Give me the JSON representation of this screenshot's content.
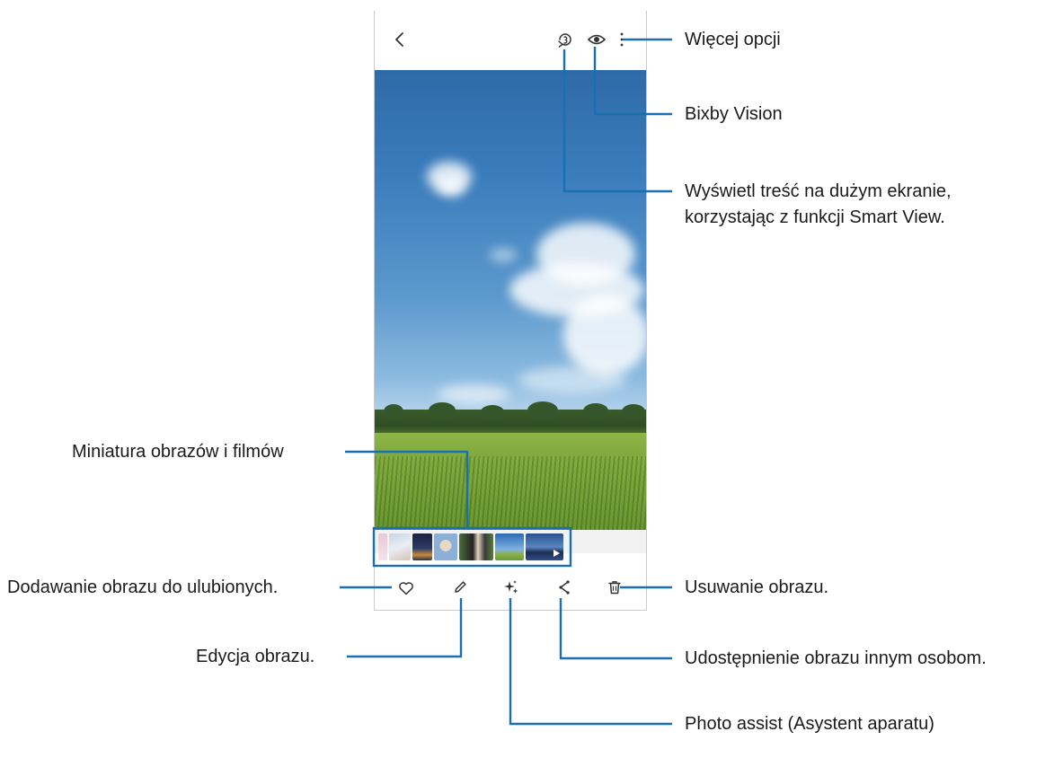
{
  "callouts": {
    "more_options": "Więcej opcji",
    "bixby_vision": "Bixby Vision",
    "smart_view_line1": "Wyświetl treść na dużym ekranie,",
    "smart_view_line2": "korzystając z funkcji Smart View.",
    "thumbnails": "Miniatura obrazów i filmów",
    "favorite": "Dodawanie obrazu do ulubionych.",
    "delete": "Usuwanie obrazu.",
    "share": "Udostępnienie obrazu innym osobom.",
    "edit": "Edycja obrazu.",
    "photo_assist": "Photo assist (Asystent aparatu)"
  },
  "icons": {
    "top": [
      "back-icon",
      "smart-view-icon",
      "eye-icon",
      "more-options-icon"
    ],
    "bottom": [
      "heart-icon",
      "pencil-icon",
      "sparkle-icon",
      "share-icon",
      "trash-icon"
    ]
  },
  "colors": {
    "callout_line": "#1a6fb0",
    "text": "#1a1a1a"
  }
}
